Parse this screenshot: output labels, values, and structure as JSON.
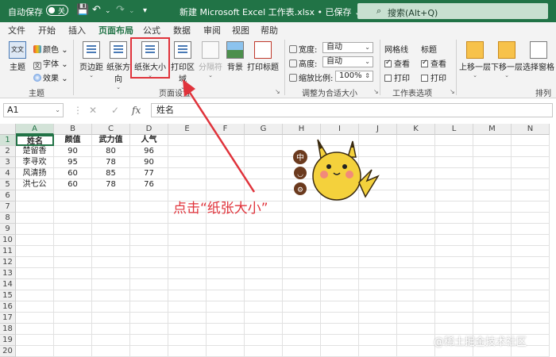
{
  "titlebar": {
    "autosave_label": "自动保存",
    "autosave_state": "关",
    "doc_title": "新建 Microsoft Excel 工作表.xlsx • 已保存",
    "doc_title_chevron": "⌄",
    "search_placeholder": "搜索(Alt+Q)",
    "qa_save": "💾",
    "qa_undo": "↶",
    "qa_undo_dd": "⌄",
    "qa_redo": "↷",
    "qa_redo_dd": "⌄",
    "qa_more": "▾",
    "search_icon": "⌕"
  },
  "menu": {
    "tabs": [
      "文件",
      "开始",
      "插入",
      "页面布局",
      "公式",
      "数据",
      "审阅",
      "视图",
      "帮助"
    ],
    "active_index": 3
  },
  "ribbon": {
    "theme_group": {
      "theme": "主题",
      "colors": "颜色",
      "fonts": "字体",
      "effects": "效果",
      "label": "主题",
      "colors_dd": "⌄",
      "fonts_dd": "⌄",
      "effects_dd": "⌄",
      "theme_icon_text": "文文",
      "fonts_icon_text": "文"
    },
    "page_setup": {
      "margins": "页边距",
      "orientation": "纸张方向",
      "size": "纸张大小",
      "print_area": "打印区域",
      "breaks": "分隔符",
      "background": "背景",
      "print_titles": "打印标题",
      "label": "页面设置",
      "margins_arrow": "⌄",
      "orientation_arrow": "⌄",
      "size_arrow": "⌄",
      "print_area_arrow": "⌄",
      "breaks_arrow": "⌄"
    },
    "scale_fit": {
      "width_label": "宽度:",
      "width_value": "自动",
      "height_label": "高度:",
      "height_value": "自动",
      "scale_label": "缩放比例:",
      "scale_value": "100%",
      "label": "调整为合适大小",
      "dd": "⌄",
      "spin": "⇕"
    },
    "sheet_options": {
      "gridlines": "网格线",
      "headings": "标题",
      "view": "查看",
      "print": "打印",
      "label": "工作表选项"
    },
    "arrange": {
      "bring_forward": "上移一层",
      "send_backward": "下移一层",
      "selection_pane": "选择窗格",
      "label": "排列",
      "bring_forward_dd": "⌄",
      "send_backward_dd": "⌄"
    },
    "dialog_launcher": "↘"
  },
  "formula_bar": {
    "name_box": "A1",
    "formula": "姓名",
    "name_dd": "⌄",
    "more": "⋮",
    "cancel": "✕",
    "enter": "✓",
    "fx": "fx"
  },
  "grid": {
    "columns": [
      "A",
      "B",
      "C",
      "D",
      "E",
      "F",
      "G",
      "H",
      "I",
      "J",
      "K",
      "L",
      "M",
      "N"
    ],
    "rows": [
      "1",
      "2",
      "3",
      "4",
      "5",
      "6",
      "7",
      "8",
      "9",
      "10",
      "11",
      "12",
      "13",
      "14",
      "15",
      "16",
      "17",
      "18",
      "19",
      "20"
    ],
    "table": [
      [
        "姓名",
        "颜值",
        "武力值",
        "人气"
      ],
      [
        "楚留香",
        "90",
        "80",
        "96"
      ],
      [
        "李寻欢",
        "95",
        "78",
        "90"
      ],
      [
        "风清扬",
        "60",
        "85",
        "77"
      ],
      [
        "洪七公",
        "60",
        "78",
        "76"
      ]
    ]
  },
  "sticker_icons": [
    "中",
    "◡",
    "⚙"
  ],
  "annotation": "点击“纸张大小”",
  "watermark": "@稀土掘金技术社区",
  "colors": {
    "excel_green": "#217346",
    "annotation_red": "#e0333b"
  }
}
